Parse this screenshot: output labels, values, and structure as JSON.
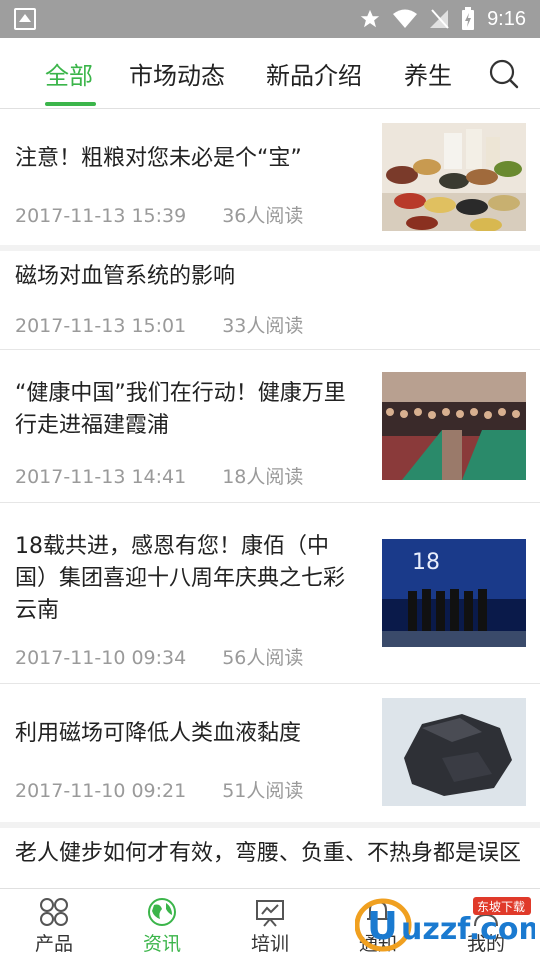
{
  "statusbar": {
    "time": "9:16"
  },
  "tabs": [
    {
      "label": "全部"
    },
    {
      "label": "市场动态"
    },
    {
      "label": "新品介绍"
    },
    {
      "label": "养生"
    }
  ],
  "articles": [
    {
      "title": "注意！粗粮对您未必是个“宝”",
      "date": "2017-11-13 15:39",
      "reads": "36人阅读"
    },
    {
      "title": "磁场对血管系统的影响",
      "date": "2017-11-13 15:01",
      "reads": "33人阅读"
    },
    {
      "title": "“健康中国”我们在行动！健康万里行走进福建霞浦",
      "date": "2017-11-13 14:41",
      "reads": "18人阅读"
    },
    {
      "title": "18载共进，感恩有您！康佰（中国）集团喜迎十八周年庆典之七彩云南",
      "date": "2017-11-10 09:34",
      "reads": "56人阅读"
    },
    {
      "title": "利用磁场可降低人类血液黏度",
      "date": "2017-11-10 09:21",
      "reads": "51人阅读"
    },
    {
      "title": "老人健步如何才有效，弯腰、负重、不热身都是误区"
    }
  ],
  "bottomnav": [
    {
      "label": "产品"
    },
    {
      "label": "资讯"
    },
    {
      "label": "培训"
    },
    {
      "label": "通知"
    },
    {
      "label": "我的"
    }
  ],
  "watermark": {
    "text": "uzzf.com",
    "subtext": "东坡下载"
  },
  "colors": {
    "accent": "#3bb54a",
    "statusbar": "#9e9e9e"
  }
}
